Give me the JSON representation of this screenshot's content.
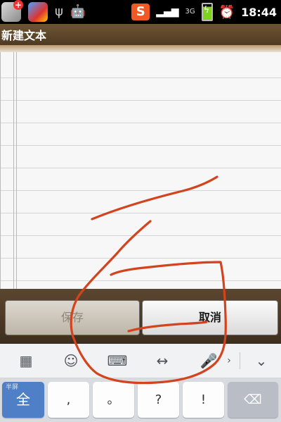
{
  "status_bar": {
    "time": "18:44",
    "sogou_label": "S",
    "network_label": "3G",
    "usb_glyph": "ψ",
    "android_glyph": "🤖",
    "app_icon_plus": "+",
    "signal_glyph": "▂▄▆"
  },
  "window": {
    "title": "新建文本"
  },
  "note": {
    "content": ""
  },
  "actions": {
    "save_label": "保存",
    "cancel_label": "取消"
  },
  "ime_toolbar": {
    "icons": [
      "grid-menu-icon",
      "emoji-icon",
      "keyboard-icon",
      "cursor-move-icon",
      "microphone-icon",
      "collapse-chevron-icon"
    ],
    "grid_glyph": "▦",
    "emoji_glyph": "☺",
    "keyboard_glyph": "⌨",
    "cursor_glyph": "↔",
    "mic_glyph": "🎤",
    "more_glyph": "›",
    "chevron_glyph": "⌄"
  },
  "keyboard": {
    "lang_small": "半屏",
    "lang_big": "全",
    "keys": [
      ",",
      "。",
      "?",
      "!"
    ],
    "delete_glyph": "⌫"
  },
  "colors": {
    "title_bar": "#4f3a22",
    "ink": "#d2431e",
    "ime_accent": "#4f7fc7"
  }
}
